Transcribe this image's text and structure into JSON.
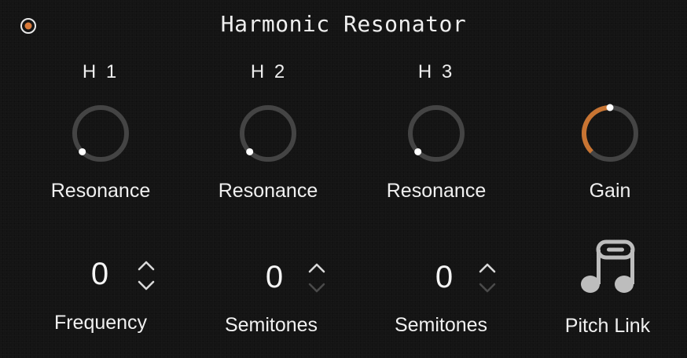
{
  "header": {
    "title": "Harmonic Resonator",
    "power_on": true
  },
  "harmonics": [
    {
      "label": "H 1",
      "knob_label": "Resonance",
      "resonance": 0.0,
      "value": "0",
      "param_label": "Frequency"
    },
    {
      "label": "H 2",
      "knob_label": "Resonance",
      "resonance": 0.0,
      "value": "0",
      "param_label": "Semitones"
    },
    {
      "label": "H 3",
      "knob_label": "Resonance",
      "resonance": 0.0,
      "value": "0",
      "param_label": "Semitones"
    }
  ],
  "gain": {
    "label": "Gain",
    "value": 0.5
  },
  "pitch_link": {
    "label": "Pitch Link",
    "icon": "music-notes-link-icon"
  },
  "colors": {
    "background": "#141414",
    "accent": "#c87432",
    "knob_track": "#444444",
    "stepper_active": "#d9d9d9",
    "stepper_disabled": "#4a4a4a"
  }
}
